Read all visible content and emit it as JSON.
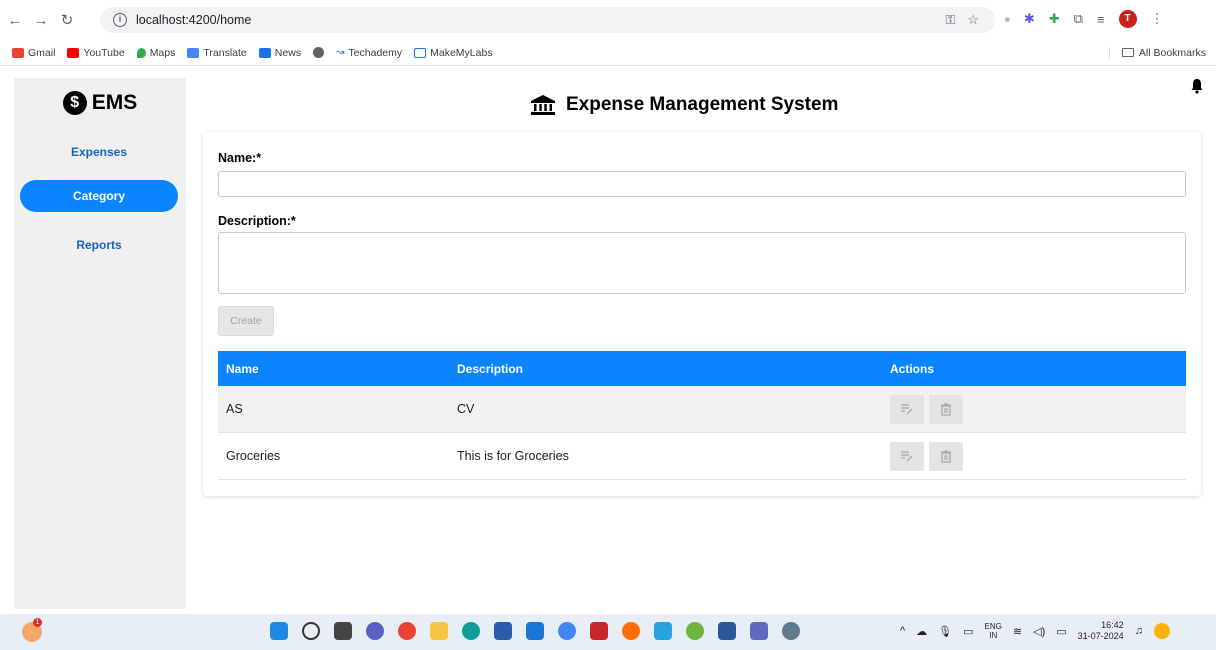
{
  "browser": {
    "url": "localhost:4200/home",
    "bookmarks": [
      "Gmail",
      "YouTube",
      "Maps",
      "Translate",
      "News",
      "",
      "Techademy",
      "MakeMyLabs"
    ],
    "all_bookmarks": "All Bookmarks",
    "profile_initial": "T"
  },
  "app": {
    "logo": "EMS",
    "logo_mark": "$",
    "page_title": "Expense Management System",
    "nav": [
      {
        "label": "Expenses",
        "active": false
      },
      {
        "label": "Category",
        "active": true
      },
      {
        "label": "Reports",
        "active": false
      }
    ],
    "form": {
      "name_label": "Name:*",
      "name_value": "",
      "description_label": "Description:*",
      "description_value": "",
      "create_label": "Create"
    },
    "table": {
      "headers": [
        "Name",
        "Description",
        "Actions"
      ],
      "rows": [
        {
          "name": "AS",
          "description": "CV"
        },
        {
          "name": "Groceries",
          "description": "This is for Groceries"
        }
      ]
    }
  },
  "taskbar": {
    "notification_count": "1",
    "lang_top": "ENG",
    "lang_bottom": "IN",
    "time": "16:42",
    "date": "31-07-2024"
  },
  "colors": {
    "accent": "#0a84ff",
    "sidebar_bg": "#f0f0f0",
    "nav_text": "#1565c0"
  }
}
